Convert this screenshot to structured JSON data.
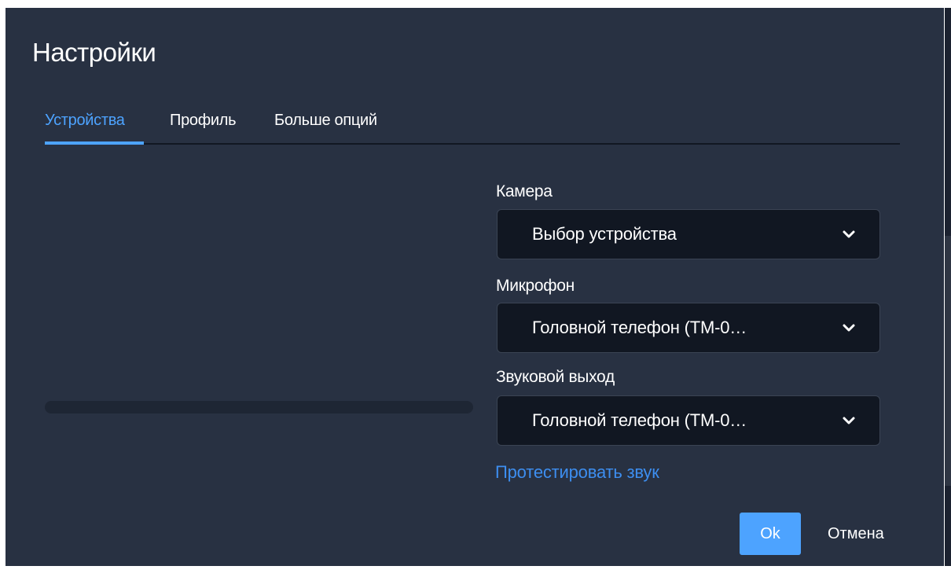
{
  "dialog": {
    "title": "Настройки"
  },
  "tabs": [
    {
      "label": "Устройства",
      "active": true
    },
    {
      "label": "Профиль",
      "active": false
    },
    {
      "label": "Больше опций",
      "active": false
    }
  ],
  "devices": {
    "camera": {
      "label": "Камера",
      "value": "Выбор устройства",
      "icon": "chevron-down-icon"
    },
    "microphone": {
      "label": "Микрофон",
      "value": "Головной телефон (ТМ-0…",
      "icon": "chevron-down-icon"
    },
    "audio_output": {
      "label": "Звуковой выход",
      "value": "Головной телефон (ТМ-0…",
      "icon": "chevron-down-icon"
    },
    "test_sound_label": "Протестировать звук"
  },
  "footer": {
    "ok_label": "Ok",
    "cancel_label": "Отмена"
  },
  "colors": {
    "dialog_background": "#283142",
    "select_background": "#111722",
    "accent": "#4da3ff",
    "link": "#3d8ef0"
  }
}
